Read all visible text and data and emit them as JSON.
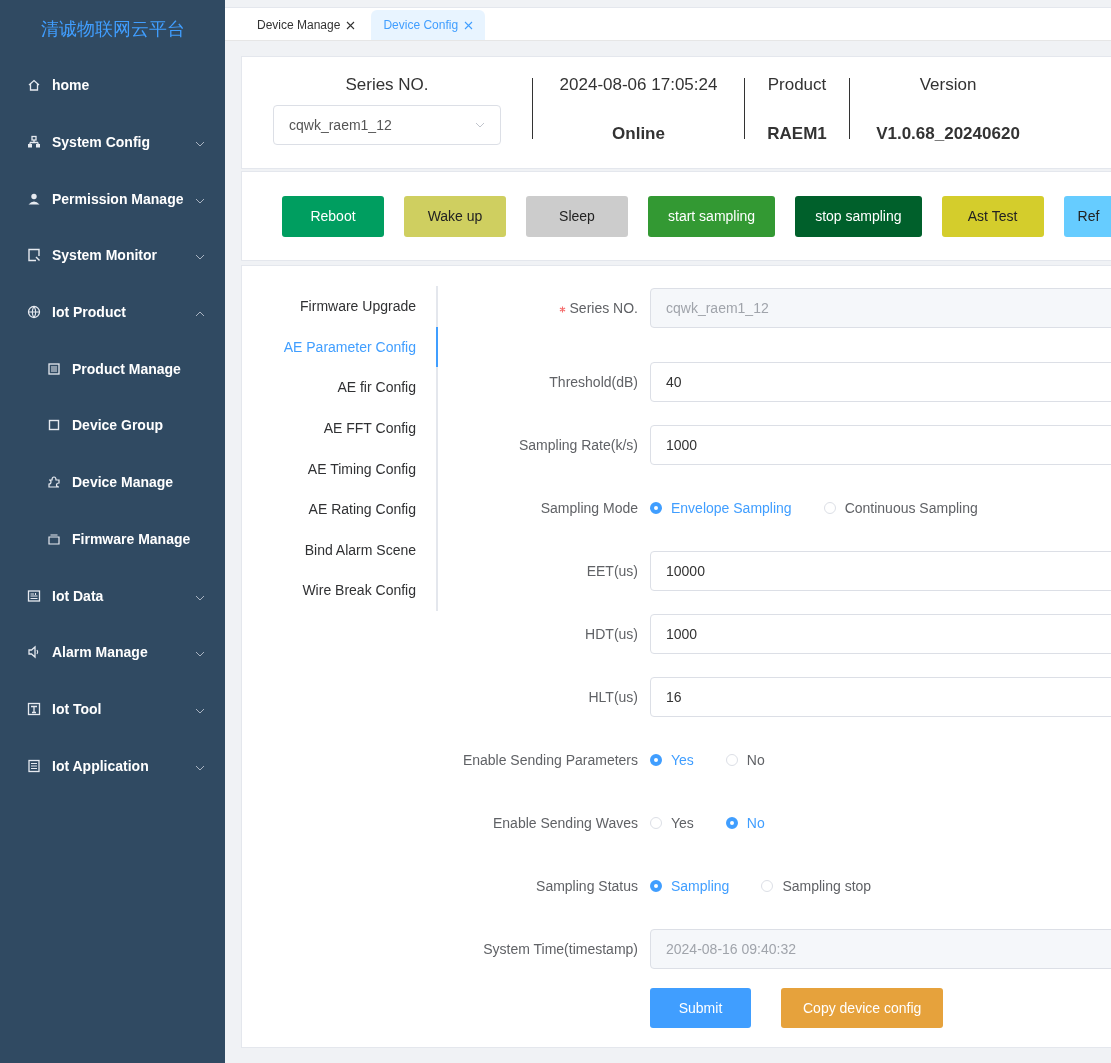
{
  "sidebar": {
    "logo": "清诚物联网云平台",
    "items": [
      {
        "label": "home"
      },
      {
        "label": "System Config",
        "expanded": false
      },
      {
        "label": "Permission Manage",
        "expanded": false
      },
      {
        "label": "System Monitor",
        "expanded": false
      },
      {
        "label": "Iot Product",
        "expanded": true,
        "children": [
          {
            "label": "Product Manage"
          },
          {
            "label": "Device Group"
          },
          {
            "label": "Device Manage"
          },
          {
            "label": "Firmware Manage"
          }
        ]
      },
      {
        "label": "Iot Data",
        "expanded": false
      },
      {
        "label": "Alarm Manage",
        "expanded": false
      },
      {
        "label": "Iot Tool",
        "expanded": false
      },
      {
        "label": "Iot Application",
        "expanded": false
      }
    ]
  },
  "tabs": [
    {
      "label": "Device Manage",
      "selected": false
    },
    {
      "label": "Device Config",
      "selected": true
    }
  ],
  "header": {
    "series_label": "Series NO.",
    "series_value": "cqwk_raem1_12",
    "time": "2024-08-06 17:05:24",
    "status": "Online",
    "product_label": "Product",
    "product_value": "RAEM1",
    "version_label": "Version",
    "version_value": "V1.0.68_20240620"
  },
  "actions": [
    {
      "label": "Reboot",
      "color": "#009e60"
    },
    {
      "label": "Wake up",
      "color": "#cfcf60"
    },
    {
      "label": "Sleep",
      "color": "#cccccc"
    },
    {
      "label": "start sampling",
      "color": "#339933"
    },
    {
      "label": "stop sampling",
      "color": "#00602b"
    },
    {
      "label": "Ast Test",
      "color": "#d4cd2c"
    },
    {
      "label": "Ref",
      "color": "#66ccff"
    }
  ],
  "config_tabs": [
    {
      "label": "Firmware Upgrade",
      "selected": false
    },
    {
      "label": "AE Parameter Config",
      "selected": true
    },
    {
      "label": "AE fir Config",
      "selected": false
    },
    {
      "label": "AE FFT Config",
      "selected": false
    },
    {
      "label": "AE Timing Config",
      "selected": false
    },
    {
      "label": "AE Rating Config",
      "selected": false
    },
    {
      "label": "Bind Alarm Scene",
      "selected": false
    },
    {
      "label": "Wire Break Config",
      "selected": false
    }
  ],
  "form": [
    {
      "kind": "input",
      "label": "Series NO.",
      "required": true,
      "value": "cqwk_raem1_12",
      "disabled": true
    },
    {
      "kind": "input",
      "label": "Threshold(dB)",
      "value": "40",
      "disabled": false
    },
    {
      "kind": "input",
      "label": "Sampling Rate(k/s)",
      "value": "1000",
      "disabled": false
    },
    {
      "kind": "radio",
      "label": "Sampling Mode",
      "options": [
        {
          "label": "Envelope Sampling",
          "selected": true
        },
        {
          "label": "Continuous Sampling",
          "selected": false
        }
      ]
    },
    {
      "kind": "input",
      "label": "EET(us)",
      "value": "10000",
      "disabled": false
    },
    {
      "kind": "input",
      "label": "HDT(us)",
      "value": "1000",
      "disabled": false
    },
    {
      "kind": "input",
      "label": "HLT(us)",
      "value": "16",
      "disabled": false
    },
    {
      "kind": "radio",
      "label": "Enable Sending Parameters",
      "options": [
        {
          "label": "Yes",
          "selected": true
        },
        {
          "label": "No",
          "selected": false
        }
      ]
    },
    {
      "kind": "radio",
      "label": "Enable Sending Waves",
      "options": [
        {
          "label": "Yes",
          "selected": false
        },
        {
          "label": "No",
          "selected": true
        }
      ]
    },
    {
      "kind": "radio",
      "label": "Sampling Status",
      "options": [
        {
          "label": "Sampling",
          "selected": true
        },
        {
          "label": "Sampling stop",
          "selected": false
        }
      ]
    },
    {
      "kind": "input",
      "label": "System Time(timestamp)",
      "value": "2024-08-16 09:40:32",
      "disabled": true
    }
  ],
  "form_buttons": [
    {
      "label": "Submit",
      "kind": "primary"
    },
    {
      "label": "Copy device config",
      "kind": "warning"
    }
  ]
}
